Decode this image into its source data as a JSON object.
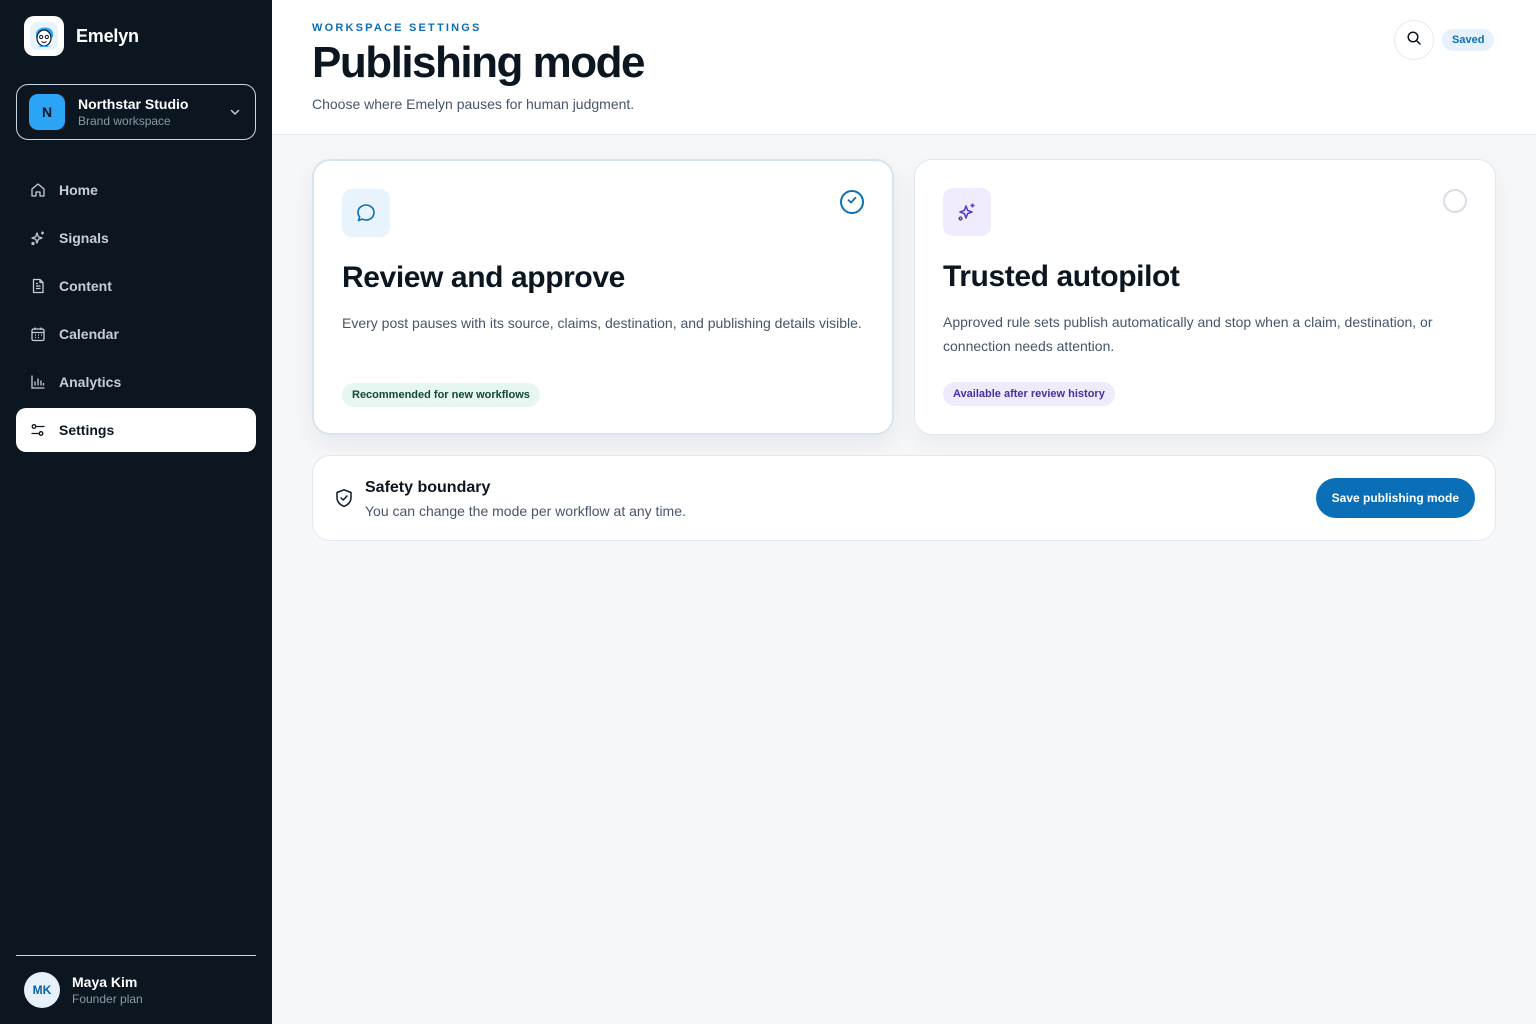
{
  "app": {
    "name": "Emelyn",
    "logo_icon": "avatar-face-icon"
  },
  "workspace": {
    "initial": "N",
    "name": "Northstar Studio",
    "subtitle": "Brand workspace"
  },
  "nav": {
    "items": [
      {
        "label": "Home",
        "icon": "home-icon",
        "active": false
      },
      {
        "label": "Signals",
        "icon": "sparkle-icon",
        "active": false
      },
      {
        "label": "Content",
        "icon": "document-icon",
        "active": false
      },
      {
        "label": "Calendar",
        "icon": "calendar-icon",
        "active": false
      },
      {
        "label": "Analytics",
        "icon": "bar-chart-icon",
        "active": false
      },
      {
        "label": "Settings",
        "icon": "sliders-icon",
        "active": true
      }
    ]
  },
  "user": {
    "initials": "MK",
    "name": "Maya Kim",
    "plan": "Founder plan"
  },
  "header": {
    "eyebrow": "WORKSPACE SETTINGS",
    "title": "Publishing mode",
    "description": "Choose where Emelyn pauses for human judgment.",
    "saved_label": "Saved"
  },
  "modes": [
    {
      "title": "Review and approve",
      "description": "Every post pauses with its source, claims, destination, and publishing details visible.",
      "tag": "Recommended for new workflows",
      "icon": "chat-bubble-icon",
      "selected": true
    },
    {
      "title": "Trusted autopilot",
      "description": "Approved rule sets publish automatically and stop when a claim, destination, or connection needs attention.",
      "tag": "Available after review history",
      "icon": "sparkle-icon",
      "selected": false
    }
  ],
  "safety": {
    "title": "Safety boundary",
    "description": "You can change the mode per workflow at any time.",
    "save_label": "Save publishing mode"
  },
  "colors": {
    "sidebar_bg": "#0b1620",
    "accent": "#0b6fb8",
    "page_bg": "#f6f7f9"
  }
}
